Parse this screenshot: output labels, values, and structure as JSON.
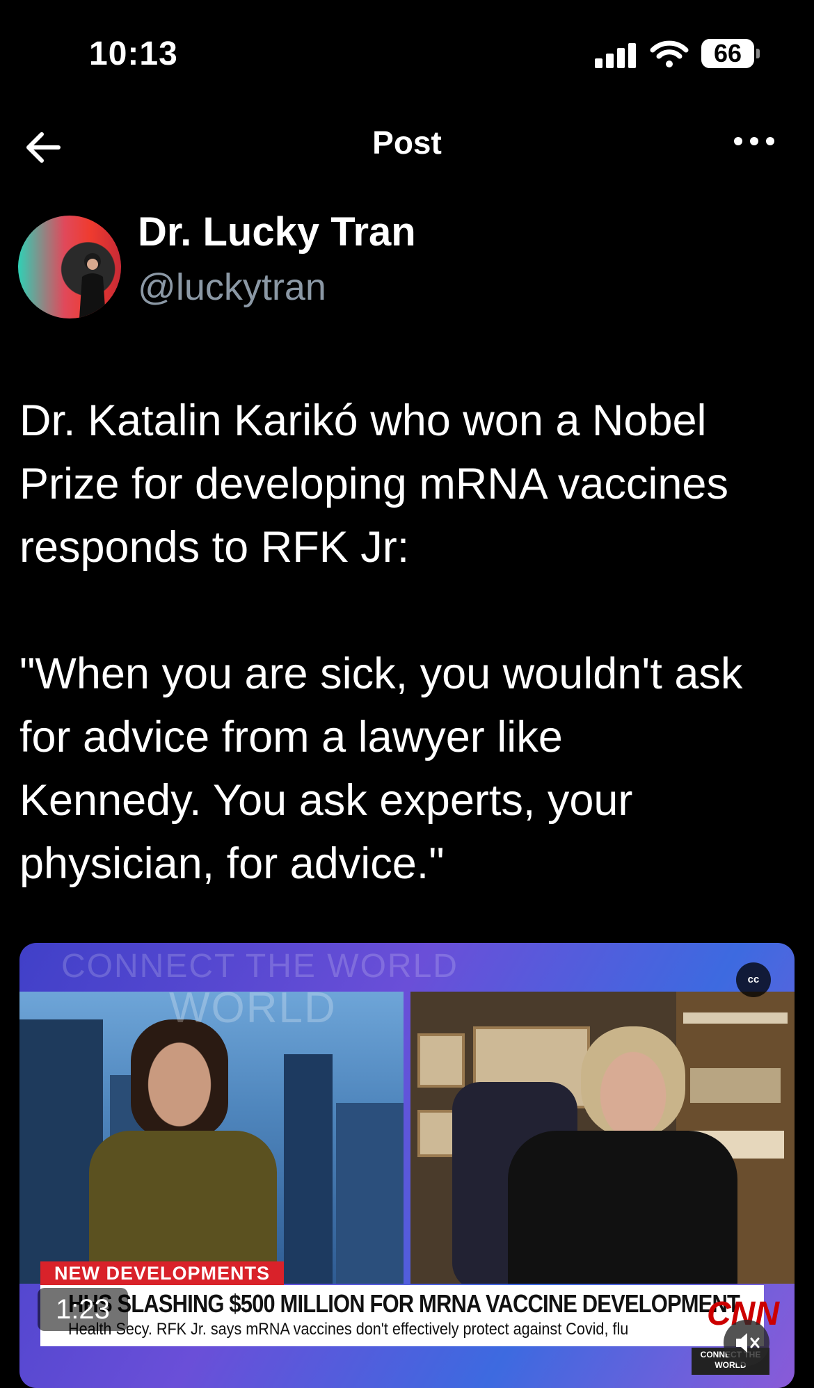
{
  "status_bar": {
    "time": "10:13",
    "battery": "66"
  },
  "nav": {
    "title": "Post"
  },
  "author": {
    "name": "Dr. Lucky Tran",
    "handle": "@luckytran"
  },
  "post": {
    "text": "Dr. Katalin Karikó who won a Nobel\nPrize for developing mRNA vaccines\nresponds to RFK Jr:\n\n\"When you are sick, you wouldn't ask\nfor advice from a lawyer like\nKennedy. You ask experts, your\nphysician, for advice.\""
  },
  "media": {
    "background_text_1": "CONNECT THE WORLD",
    "background_text_2": "WORLD",
    "cc_label": "cc",
    "tag": "NEW DEVELOPMENTS",
    "headline": "HHS SLASHING $500 MILLION FOR MRNA VACCINE DEVELOPMENT",
    "subline": "Health Secy. RFK Jr. says mRNA vaccines don't effectively protect against Covid, flu",
    "network": "CNN",
    "badge": "CONNECT THE WORLD",
    "timestamp": "1:23"
  },
  "icons": {
    "back": "arrow-left-icon",
    "more": "more-horizontal-icon",
    "mute": "speaker-muted-icon"
  }
}
